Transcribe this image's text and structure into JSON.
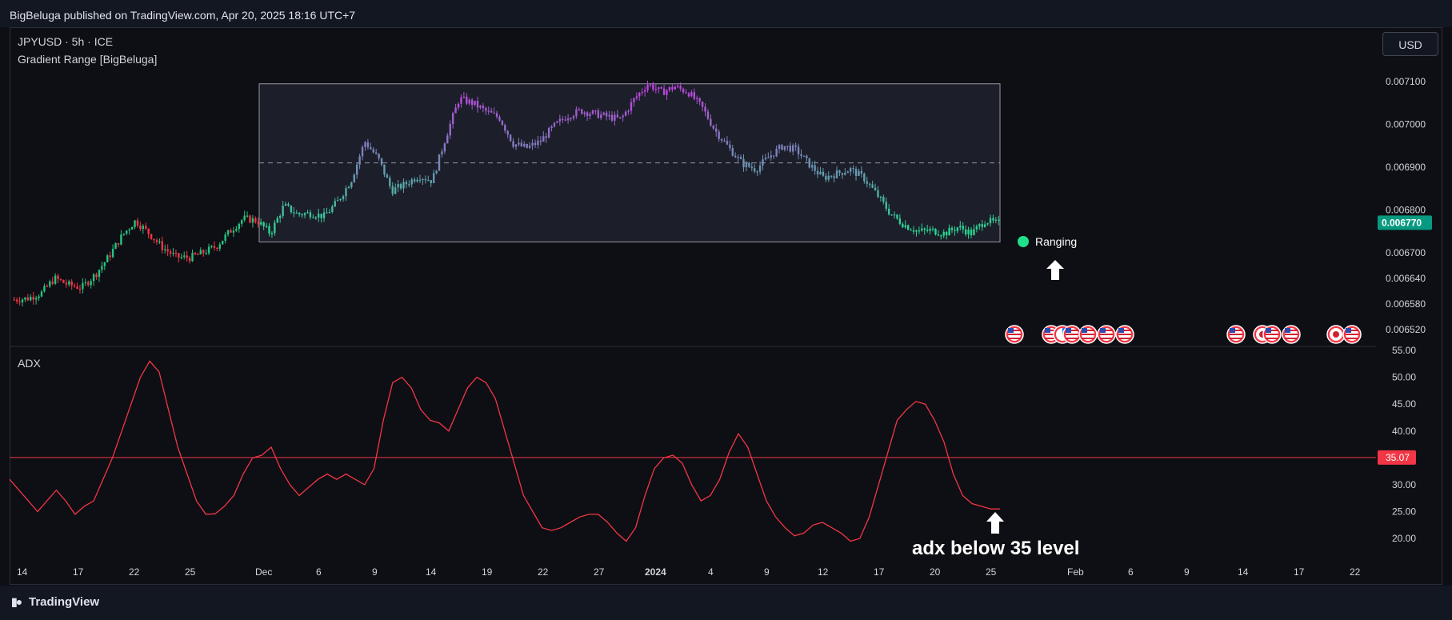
{
  "header": {
    "text": "BigBeluga published on TradingView.com, Apr 20, 2025 18:16 UTC+7"
  },
  "legend": {
    "symbol": "JPYUSD · 5h · ICE",
    "indicator": "Gradient Range [BigBeluga]",
    "adx_label": "ADX"
  },
  "currency_button": "USD",
  "footer": {
    "brand": "TradingView"
  },
  "colors": {
    "bull": "#26c281",
    "bear": "#f23645",
    "adx_line": "#f23645",
    "range_high": "#c040e0",
    "range_low": "#20e08a",
    "price_tag": "#089981",
    "level_tag": "#f23645"
  },
  "chart_data": [
    {
      "type": "candlestick",
      "title": "",
      "price_axis_ticks": [
        "0.007100",
        "0.007000",
        "0.006900",
        "0.006800",
        "0.006700",
        "0.006640",
        "0.006580",
        "0.006520"
      ],
      "last_price": "0.006770",
      "ylim": [
        0.00649,
        0.00716
      ],
      "range_box": {
        "top": 0.007095,
        "bottom": 0.006725,
        "mid": 0.00691
      },
      "annotations": [
        "Ranging"
      ],
      "x_ticks": [
        "14",
        "17",
        "22",
        "25",
        "Dec",
        "6",
        "9",
        "14",
        "19",
        "22",
        "27",
        "2024",
        "4",
        "9",
        "12",
        "17",
        "20",
        "25",
        "Feb",
        "6",
        "9",
        "14",
        "17",
        "22"
      ],
      "close_path": [
        0.00659,
        0.006593,
        0.006605,
        0.00664,
        0.006625,
        0.006618,
        0.006648,
        0.00669,
        0.00674,
        0.006775,
        0.006745,
        0.006712,
        0.00669,
        0.006688,
        0.0067,
        0.006715,
        0.00675,
        0.00678,
        0.006775,
        0.006745,
        0.00681,
        0.00679,
        0.006792,
        0.006785,
        0.00682,
        0.00687,
        0.00696,
        0.00692,
        0.006845,
        0.00686,
        0.00688,
        0.006868,
        0.00697,
        0.00706,
        0.00705,
        0.00703,
        0.007015,
        0.006955,
        0.006945,
        0.00696,
        0.006995,
        0.00702,
        0.007032,
        0.007025,
        0.007018,
        0.007012,
        0.00706,
        0.007095,
        0.007075,
        0.007088,
        0.007075,
        0.00704,
        0.006985,
        0.006945,
        0.006908,
        0.006895,
        0.006925,
        0.00695,
        0.00694,
        0.006905,
        0.006875,
        0.006885,
        0.006895,
        0.006875,
        0.006835,
        0.00679,
        0.006765,
        0.00675,
        0.006752,
        0.006745,
        0.00676,
        0.006745,
        0.006775,
        0.006768
      ],
      "events": [
        "us-flag",
        "us-flag",
        "pie-badge",
        "us-flag",
        "us-flag",
        "us-flag",
        "us-flag",
        "us-flag",
        "jp-flag",
        "us-flag",
        "us-flag",
        "jp-flag",
        "us-flag"
      ]
    },
    {
      "type": "line",
      "title": "ADX",
      "y_ticks": [
        "55.00",
        "50.00",
        "45.00",
        "40.00",
        "35.00",
        "30.00",
        "25.00",
        "20.00"
      ],
      "ylim": [
        16,
        55
      ],
      "level": {
        "value": 35.07,
        "label": "35.07"
      },
      "series": [
        {
          "values": [
            31,
            29,
            27,
            25,
            27,
            29,
            27,
            24.5,
            26,
            27,
            31,
            35,
            40,
            45,
            50,
            53,
            51,
            44,
            37,
            32,
            27,
            24.5,
            24.6,
            26,
            28,
            32,
            35,
            35.5,
            37,
            33,
            30,
            28,
            29.5,
            31,
            32,
            31,
            32,
            31,
            30,
            33,
            42,
            49,
            50,
            48,
            44,
            42,
            41.5,
            40,
            44,
            48,
            50,
            49,
            46,
            40,
            34,
            28,
            25,
            22,
            21.5,
            22,
            23,
            24,
            24.5,
            24.5,
            23,
            21,
            19.5,
            22,
            28,
            33,
            35,
            35.5,
            34,
            30,
            27,
            28,
            31,
            36,
            39.5,
            37,
            32,
            27,
            24,
            22,
            20.5,
            21,
            22.5,
            23,
            22,
            21,
            19.5,
            20,
            24,
            30,
            36,
            42,
            44,
            45.5,
            45,
            42,
            38,
            32,
            28,
            26.5,
            26,
            25.5,
            25.5
          ]
        }
      ],
      "x_ticks": [
        "14",
        "17",
        "22",
        "25",
        "Dec",
        "6",
        "9",
        "14",
        "19",
        "22",
        "27",
        "2024",
        "4",
        "9",
        "12",
        "17",
        "20",
        "25",
        "Feb",
        "6",
        "9",
        "14",
        "17",
        "22"
      ],
      "annotations": [
        "adx below 35 level"
      ]
    }
  ]
}
